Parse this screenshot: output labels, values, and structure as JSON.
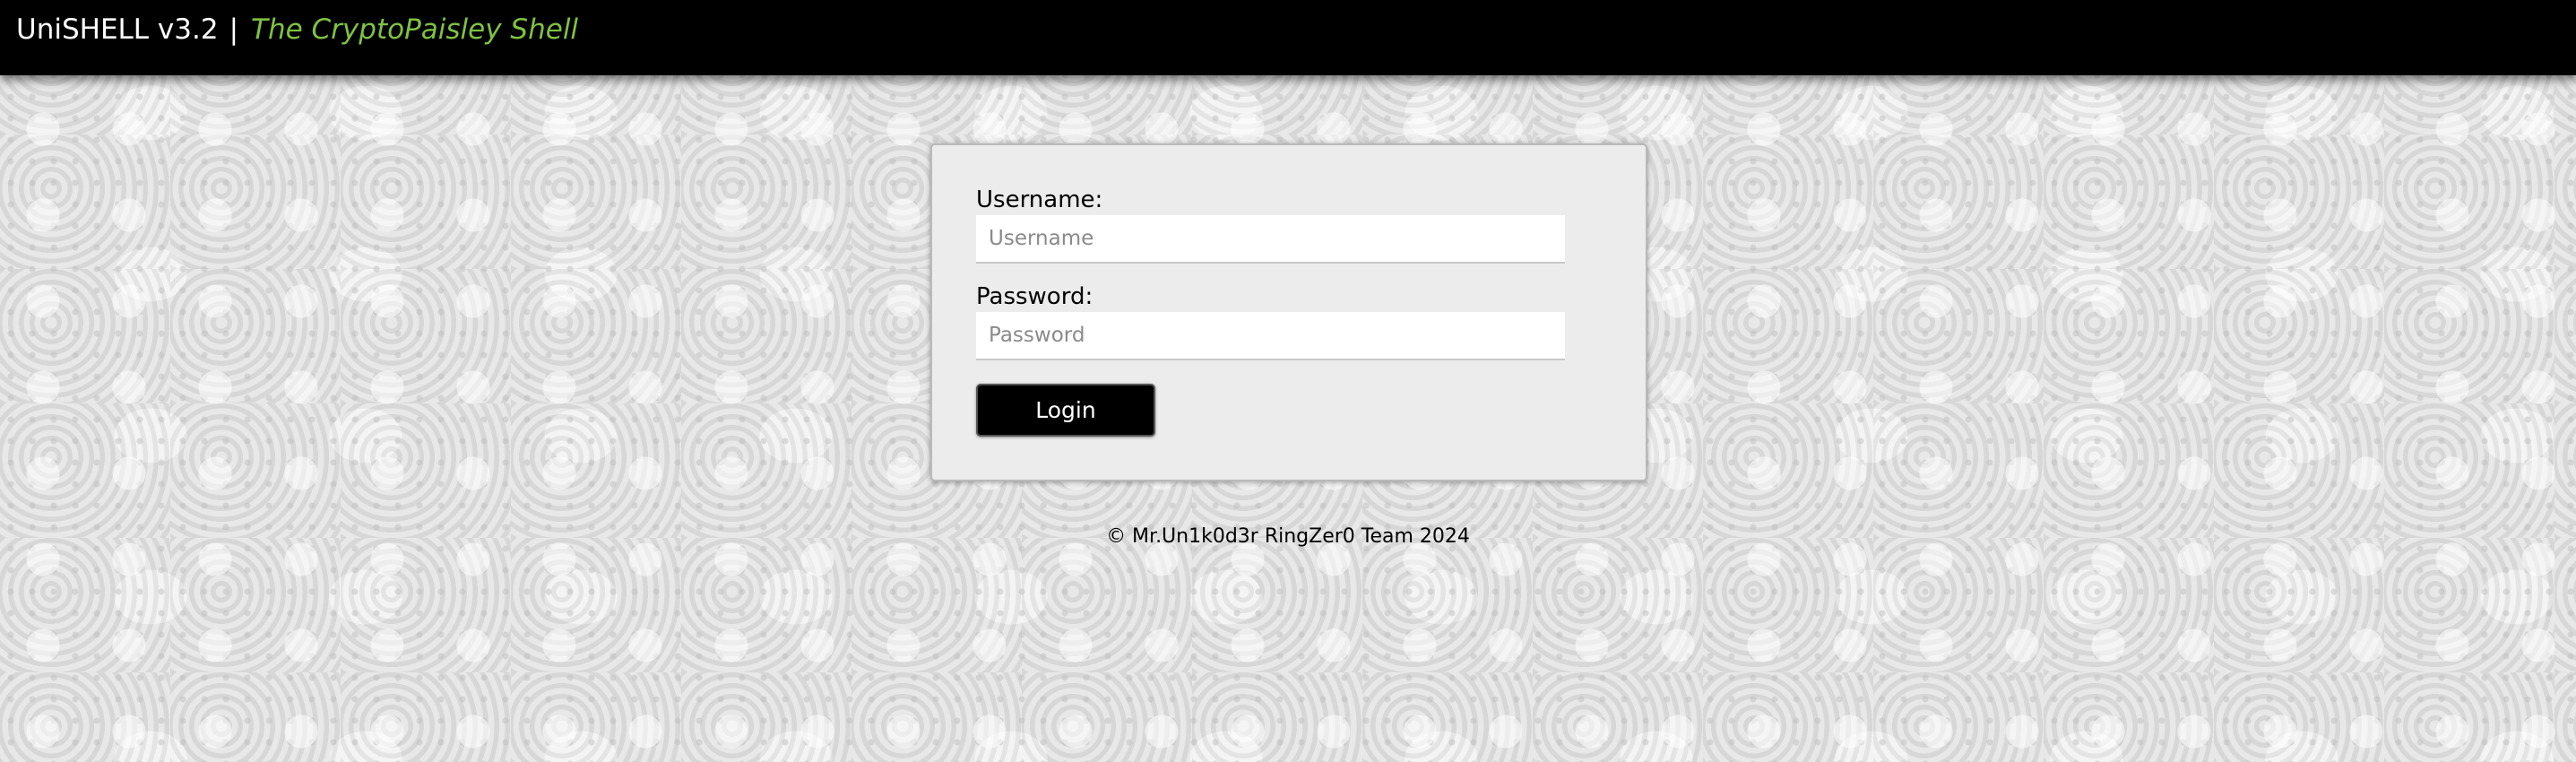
{
  "header": {
    "app_name": "UniSHELL v3.2",
    "separator": "|",
    "tagline": "The CryptoPaisley Shell"
  },
  "login_form": {
    "username_label": "Username:",
    "username_placeholder": "Username",
    "username_value": "",
    "password_label": "Password:",
    "password_placeholder": "Password",
    "password_value": "",
    "submit_label": "Login"
  },
  "footer": {
    "copyright": "© Mr.Un1k0d3r RingZer0 Team 2024"
  },
  "colors": {
    "topbar_bg": "#000000",
    "tagline": "#7fc241",
    "panel_bg": "#ececec",
    "button_bg": "#000000"
  }
}
